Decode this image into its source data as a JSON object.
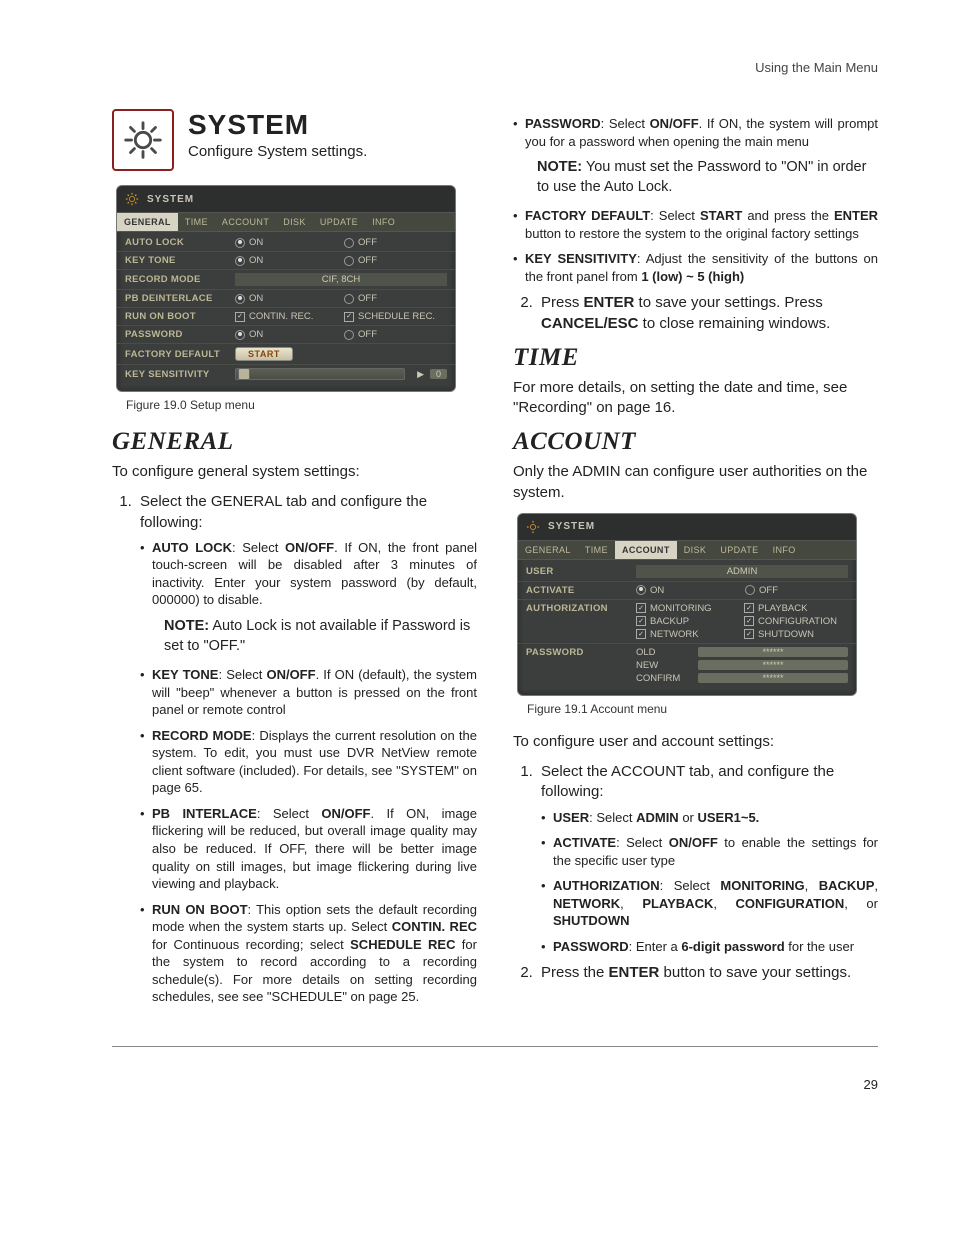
{
  "runningHead": "Using the Main Menu",
  "pageNumber": "29",
  "system": {
    "title": "SYSTEM",
    "subtitle": "Configure System settings."
  },
  "fig190": {
    "caption": "Figure 19.0 Setup menu",
    "title": "SYSTEM",
    "tabs": [
      "GENERAL",
      "TIME",
      "ACCOUNT",
      "DISK",
      "UPDATE",
      "INFO"
    ],
    "rows": {
      "autoLock": "AUTO LOCK",
      "autoLockOn": "ON",
      "autoLockOff": "OFF",
      "keyTone": "KEY TONE",
      "keyToneOn": "ON",
      "keyToneOff": "OFF",
      "recordMode": "RECORD MODE",
      "recordModeVal": "CIF, 8CH",
      "pbDe": "PB DEINTERLACE",
      "pbDeOn": "ON",
      "pbDeOff": "OFF",
      "runOnBoot": "RUN ON BOOT",
      "rob1": "CONTIN. REC.",
      "rob2": "SCHEDULE REC.",
      "password": "PASSWORD",
      "pwOn": "ON",
      "pwOff": "OFF",
      "factory": "FACTORY DEFAULT",
      "start": "START",
      "keySens": "KEY SENSITIVITY",
      "ksVal": "0"
    }
  },
  "general": {
    "heading": "GENERAL",
    "intro": "To configure general system settings:",
    "step1Lead": "Select the GENERAL tab and configure the following:",
    "autoLock": {
      "label": "AUTO LOCK",
      "sep": ": Select ",
      "bold2": "ON/OFF",
      "rest": ". If ON, the front panel touch-screen will be disabled after 3 minutes of inactivity. Enter your system password (by default, 000000) to disable."
    },
    "note1": {
      "label": "NOTE:",
      "text": " Auto Lock is not available if Password is set to \"OFF.\""
    },
    "keyTone": {
      "label": "KEY TONE",
      "sep": ": Select ",
      "bold2": "ON/OFF",
      "rest": ". If ON (default), the system will \"beep\" whenever a button is pressed on the front panel or remote control"
    },
    "recordMode": {
      "label": "RECORD MODE",
      "rest": ": Displays the current resolution on the system. To edit, you must use DVR NetView remote client software (included). For details, see \"SYSTEM\" on page 65."
    },
    "pbInterlace": {
      "label": "PB INTERLACE",
      "sep": ": Select ",
      "bold2": "ON/OFF",
      "rest": ". If ON, image flickering will be reduced, but overall image quality may also be reduced. If OFF, there will be better image quality on still images, but image flickering during live viewing and playback."
    },
    "runOnBoot": {
      "label": "RUN ON BOOT",
      "pre": ": This option sets the default recording mode when the system starts up. Select ",
      "b1": "CONTIN. REC",
      "mid": " for Continuous recording; select ",
      "b2": "SCHEDULE REC",
      "post": " for the system to record according to a recording schedule(s). For more details on setting recording schedules, see see \"SCHEDULE\" on page 25."
    },
    "password": {
      "label": "PASSWORD",
      "sep": ": Select ",
      "bold2": "ON/OFF",
      "rest": ". If ON, the system will prompt you for a password when opening the main menu"
    },
    "note2": {
      "label": "NOTE:",
      "text": " You must set the Password to \"ON\" in order to use the Auto Lock."
    },
    "factoryDefault": {
      "label": "FACTORY DEFAULT",
      "sep": ": Select ",
      "b1": "START",
      "mid": " and press the ",
      "b2": "ENTER",
      "post": " button to restore the system to the original factory settings"
    },
    "keySensitivity": {
      "label": "KEY SENSITIVITY",
      "pre": ": Adjust the sensitivity of the buttons on the front panel from ",
      "b1": "1 (low) ~ 5 (high)"
    },
    "step2": {
      "pre": "Press ",
      "b1": "ENTER",
      "mid": " to save your settings. Press ",
      "b2": "CANCEL/ESC",
      "post": " to close remaining windows."
    }
  },
  "time": {
    "heading": "TIME",
    "body": "For more details, on setting the date and time, see \"Recording\" on page 16."
  },
  "account": {
    "heading": "ACCOUNT",
    "intro": "Only the ADMIN can configure user authorities on the system.",
    "figCaption": "Figure 19.1 Account menu",
    "figTitle": "SYSTEM",
    "figTabs": [
      "GENERAL",
      "TIME",
      "ACCOUNT",
      "DISK",
      "UPDATE",
      "INFO"
    ],
    "rows": {
      "user": "USER",
      "admin": "ADMIN",
      "activate": "ACTIVATE",
      "actOn": "ON",
      "actOff": "OFF",
      "auth": "AUTHORIZATION",
      "mon": "MONITORING",
      "pb": "PLAYBACK",
      "bk": "BACKUP",
      "cfg": "CONFIGURATION",
      "net": "NETWORK",
      "sd": "SHUTDOWN",
      "pwd": "PASSWORD",
      "old": "OLD",
      "new": "NEW",
      "confirm": "CONFIRM",
      "mask": "******"
    },
    "lead": "To configure user and account settings:",
    "step1": "Select the ACCOUNT tab, and configure the following:",
    "user": {
      "label": "USER",
      "sep": ": Select ",
      "b1": "ADMIN",
      "mid": " or ",
      "b2": "USER1~5."
    },
    "activate": {
      "label": "ACTIVATE",
      "sep": ": Select ",
      "b1": "ON/OFF",
      "post": " to enable the settings for the specific user type"
    },
    "authorization": {
      "label": "AUTHORIZATION",
      "sep": ": Select ",
      "b1": "MONITORING",
      "c1": ", ",
      "b2": "BACKUP",
      "c2": ", ",
      "b3": "NETWORK",
      "c3": ", ",
      "b4": "PLAYBACK",
      "c4": ", ",
      "b5": "CONFIGURATION",
      "c5": ", or ",
      "b6": "SHUTDOWN"
    },
    "password": {
      "label": "PASSWORD",
      "sep": ": Enter a ",
      "b1": "6-digit password",
      "post": " for the user"
    },
    "step2": {
      "pre": "Press the ",
      "b1": "ENTER",
      "post": " button to save your settings."
    }
  }
}
